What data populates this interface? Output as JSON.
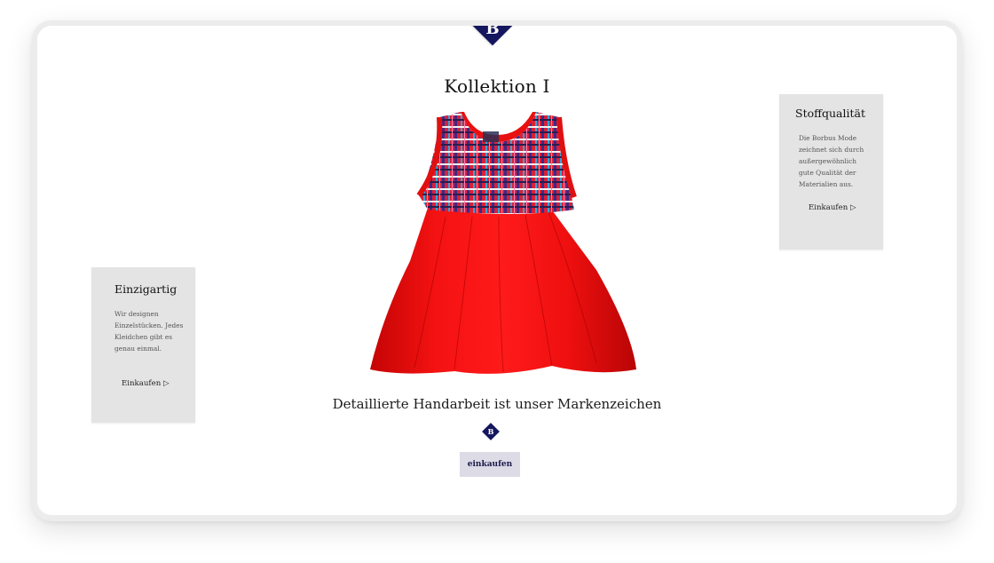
{
  "hero": {
    "title": "Kollektion I",
    "tagline": "Detaillierte Handarbeit ist unser Markenzeichen",
    "cta_label": "einkaufen",
    "logo_letter": "B"
  },
  "cards": {
    "left": {
      "heading": "Einzigartig",
      "body": "Wir designen Einzelstücken. Jedes Kleidchen gibt es genau einmal.",
      "link": "Einkaufen ▷"
    },
    "right": {
      "heading": "Stoffqualität",
      "body": "Die Borbus Mode zeichnet sich durch außergewöhnlich gute Qualität der Materialien aus.",
      "link": "Einkaufen ▷"
    }
  },
  "colors": {
    "brand": "#14165e",
    "dress": "#f20d0d",
    "card_bg": "#e4e4e4",
    "button_bg": "#dcdbe6"
  }
}
